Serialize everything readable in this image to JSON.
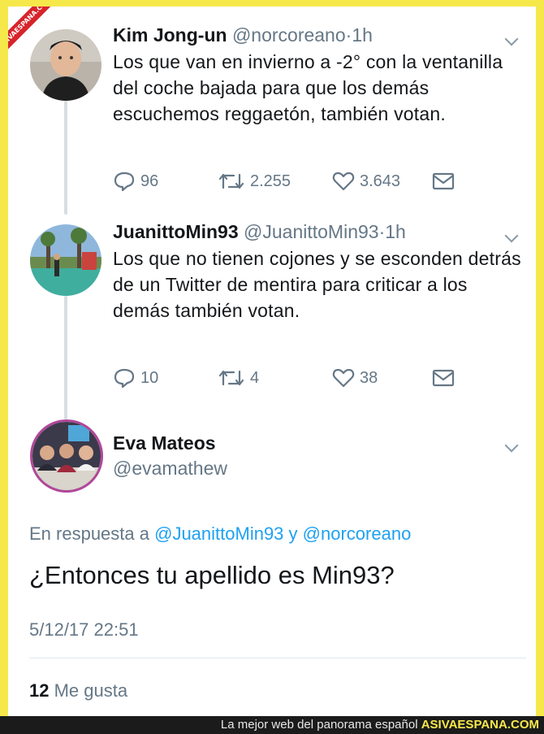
{
  "badge": "ASIVAESPANA.COM",
  "tweets": [
    {
      "name": "Kim Jong-un",
      "handle": "@norcoreano",
      "separator": "·",
      "time": "1h",
      "text": "Los que van en invierno a -2° con la ventanilla del coche bajada para que los demás escuchemos reggaetón, también votan.",
      "replies": "96",
      "retweets": "2.255",
      "likes": "3.643"
    },
    {
      "name": "JuanittoMin93",
      "handle": "@JuanittoMin93",
      "separator": "·",
      "time": "1h",
      "text": "Los que no tienen cojones y se esconden detrás de un Twitter de mentira para criticar a los demás también votan.",
      "replies": "10",
      "retweets": "4",
      "likes": "38"
    }
  ],
  "main": {
    "name": "Eva Mateos",
    "handle": "@evamathew",
    "reply_prefix": "En respuesta a",
    "reply_user1": "@JuanittoMin93",
    "reply_and": "y",
    "reply_user2": "@norcoreano",
    "text": "¿Entonces tu apellido es Min93?",
    "timestamp": "5/12/17 22:51",
    "likes_count": "12",
    "likes_label": "Me gusta"
  },
  "footer": {
    "text": "La mejor web del panorama español",
    "site": "ASIVAESPANA.COM"
  },
  "colors": {
    "accent": "#1da1f2",
    "muted": "#657786",
    "frame": "#f6e84a"
  }
}
